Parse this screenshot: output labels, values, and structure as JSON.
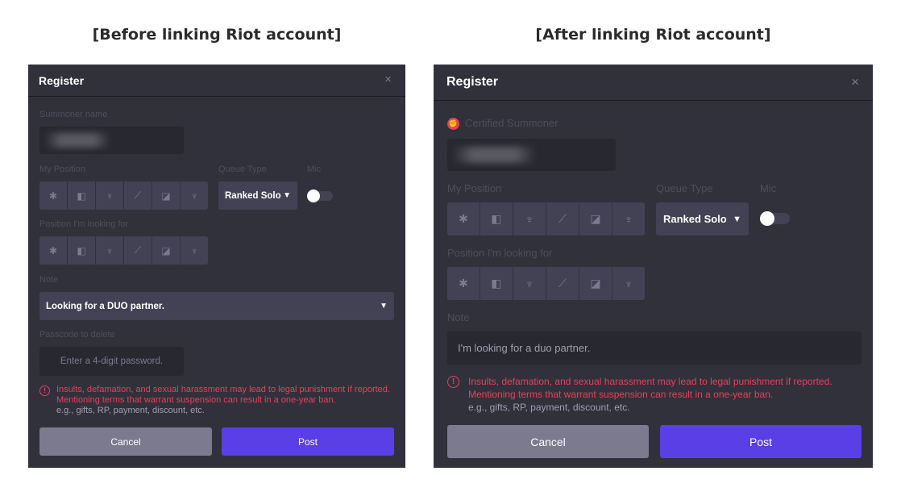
{
  "captions": {
    "before": "[Before linking Riot account]",
    "after": "[After linking Riot account]"
  },
  "before": {
    "title": "Register",
    "close": "×",
    "summoner_label": "Summoner name",
    "my_position_label": "My Position",
    "queue_type_label": "Queue Type",
    "mic_label": "Mic",
    "queue_value": "Ranked Solo",
    "position_looking_label": "Position I'm looking for",
    "note_label": "Note",
    "note_value": "Looking for a DUO partner.",
    "passcode_label": "Passcode to delete",
    "passcode_placeholder": "Enter a 4-digit password.",
    "warning_line1": "Insults, defamation, and sexual harassment may lead to legal punishment if reported.",
    "warning_line2": "Mentioning terms that warrant suspension can result in a one-year ban.",
    "warning_line3": "e.g., gifts, RP, payment, discount, etc.",
    "cancel_label": "Cancel",
    "post_label": "Post"
  },
  "after": {
    "title": "Register",
    "close": "×",
    "certified_label": "Certified Summoner",
    "my_position_label": "My Position",
    "queue_type_label": "Queue Type",
    "mic_label": "Mic",
    "queue_value": "Ranked Solo",
    "position_looking_label": "Position I'm looking for",
    "note_label": "Note",
    "note_value": "I'm looking for a duo partner.",
    "warning_line1": "Insults, defamation, and sexual harassment may lead to legal punishment if reported.",
    "warning_line2": "Mentioning terms that warrant suspension can result in a one-year ban.",
    "warning_line3": "e.g., gifts, RP, payment, discount, etc.",
    "cancel_label": "Cancel",
    "post_label": "Post"
  },
  "positions": [
    "fill-icon",
    "top-icon",
    "jungle-icon",
    "mid-icon",
    "bottom-icon",
    "support-icon"
  ],
  "position_glyphs": [
    "✱",
    "◧",
    "♆",
    "⟋",
    "◪",
    "♆"
  ],
  "mic_on": false,
  "colors": {
    "panel": "#31313c",
    "accent": "#5a3ee6",
    "warning": "#e84057",
    "cancel": "#7b7a8e"
  }
}
